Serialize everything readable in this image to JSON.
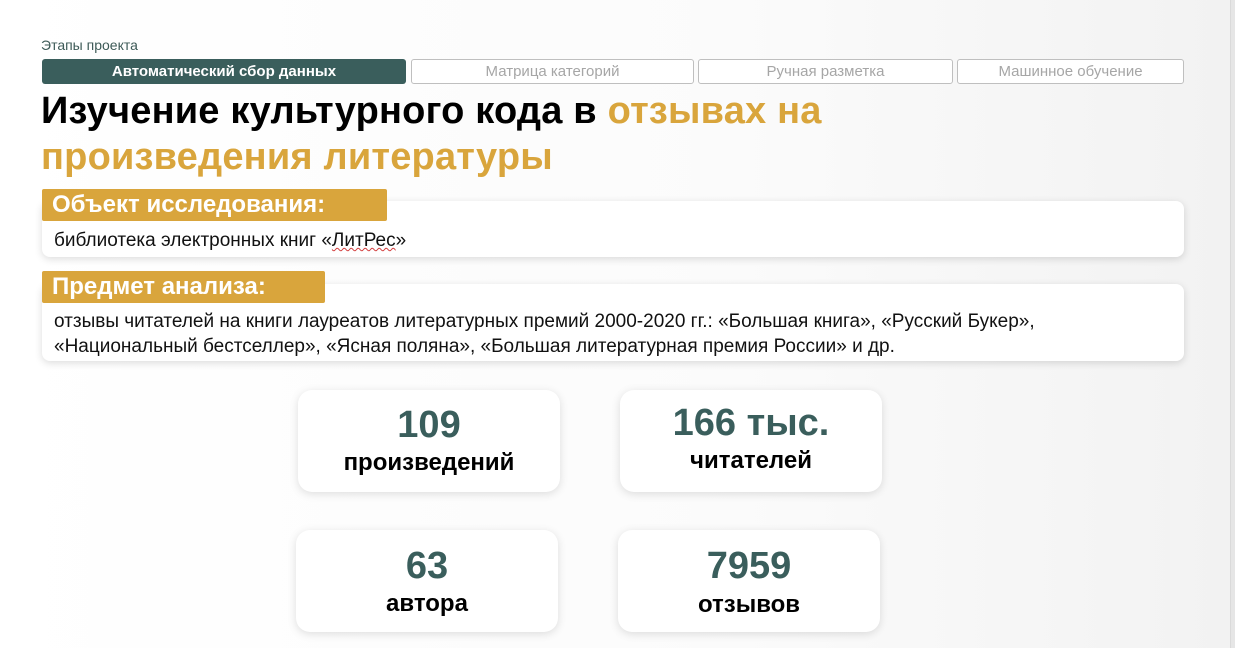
{
  "header": {
    "stages_label": "Этапы проекта",
    "stages": [
      {
        "label": "Автоматический сбор данных",
        "active": true
      },
      {
        "label": "Матрица категорий",
        "active": false
      },
      {
        "label": "Ручная разметка",
        "active": false
      },
      {
        "label": "Машинное обучение",
        "active": false
      }
    ]
  },
  "title": {
    "part1": "Изучение культурного кода в ",
    "part2_accent": "отзывах на произведения литературы"
  },
  "object": {
    "label": "Объект исследования:",
    "text_before": "библиотека электронных книг «",
    "text_marked": "ЛитРес",
    "text_after": "»"
  },
  "subject": {
    "label": "Предмет анализа:",
    "text": "отзывы читателей на книги лауреатов литературных премий 2000-2020 гг.: «Большая книга», «Русский Букер», «Национальный бестселлер», «Ясная поляна», «Большая литературная премия России» и др."
  },
  "stats": [
    {
      "value": "109",
      "caption": "произведений"
    },
    {
      "value": "166 тыс.",
      "caption": "читателей"
    },
    {
      "value": "63",
      "caption": "автора"
    },
    {
      "value": "7959",
      "caption": "отзывов"
    }
  ],
  "colors": {
    "accent": "#d9a53c",
    "primary": "#3a5e5c"
  }
}
